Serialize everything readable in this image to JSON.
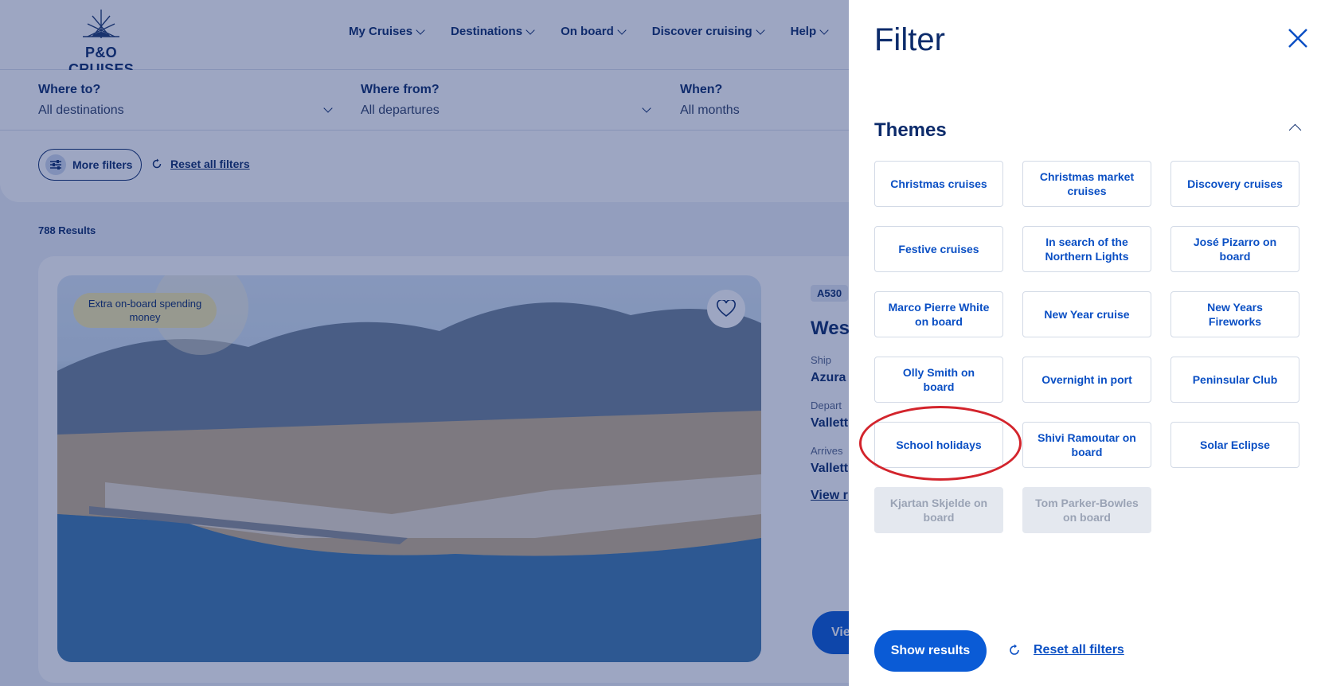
{
  "header": {
    "logo_text": "P&O CRUISES",
    "nav": [
      {
        "label": "My Cruises"
      },
      {
        "label": "Destinations"
      },
      {
        "label": "On board"
      },
      {
        "label": "Discover cruising"
      },
      {
        "label": "Help"
      }
    ]
  },
  "search": {
    "where_to": {
      "label": "Where to?",
      "value": "All destinations"
    },
    "where_from": {
      "label": "Where from?",
      "value": "All departures"
    },
    "when": {
      "label": "When?",
      "value": "All months"
    }
  },
  "filters_bar": {
    "more_filters": "More filters",
    "reset": "Reset all filters"
  },
  "results": {
    "count": "788 Results"
  },
  "card": {
    "badge": "Extra on-board spending money",
    "code": "A530",
    "title": "Wes",
    "ship_label": "Ship",
    "ship_value": "Azura",
    "depart_label": "Depart",
    "depart_value": "Vallett",
    "arrive_label": "Arrives",
    "arrive_value": "Vallett",
    "view_link": "View r",
    "view_button": "Vie"
  },
  "panel": {
    "title": "Filter",
    "themes_heading": "Themes",
    "themes": [
      {
        "label": "Christmas cruises",
        "disabled": false
      },
      {
        "label": "Christmas market cruises",
        "disabled": false
      },
      {
        "label": "Discovery cruises",
        "disabled": false
      },
      {
        "label": "Festive cruises",
        "disabled": false
      },
      {
        "label": "In search of the Northern Lights",
        "disabled": false
      },
      {
        "label": "José Pizarro on board",
        "disabled": false
      },
      {
        "label": "Marco Pierre White on board",
        "disabled": false
      },
      {
        "label": "New Year cruise",
        "disabled": false
      },
      {
        "label": "New Years Fireworks",
        "disabled": false
      },
      {
        "label": "Olly Smith on board",
        "disabled": false
      },
      {
        "label": "Overnight in port",
        "disabled": false
      },
      {
        "label": "Peninsular Club",
        "disabled": false
      },
      {
        "label": "School holidays",
        "disabled": false
      },
      {
        "label": "Shivi Ramoutar on board",
        "disabled": false
      },
      {
        "label": "Solar Eclipse",
        "disabled": false
      },
      {
        "label": "Kjartan Skjelde on board",
        "disabled": true
      },
      {
        "label": "Tom Parker-Bowles on board",
        "disabled": true
      }
    ],
    "show_results": "Show results",
    "reset": "Reset all filters"
  },
  "colors": {
    "brand_navy": "#0c2b6b",
    "accent_blue": "#0a5bd6",
    "highlight_circle": "#d3242c"
  }
}
